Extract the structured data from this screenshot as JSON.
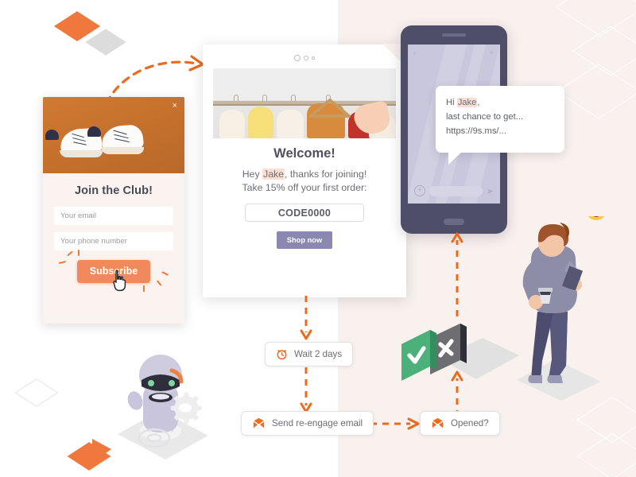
{
  "scene": {
    "title": "Marketing automation flow illustration",
    "background_left": "#ffffff",
    "background_right": "#f8f1ee",
    "accent_orange": "#f0773a",
    "accent_purple": "#8a87b0",
    "accent_green": "#4caf7d",
    "accent_dark": "#4e4e69"
  },
  "popup": {
    "name": "signup-popup",
    "close_label": "×",
    "title": "Join the Club!",
    "email_placeholder": "Your email",
    "phone_placeholder": "Your phone number",
    "email_value": "",
    "phone_value": "",
    "subscribe_label": "Subscribe",
    "hero_bg": "#c4702c"
  },
  "email": {
    "name": "welcome-email",
    "heading": "Welcome!",
    "greeting_prefix": "Hey ",
    "greeting_name": "Jake",
    "greeting_suffix": ", thanks for joining!",
    "offer_line": "Take 15% off your first order:",
    "promo_code": "CODE0000",
    "cta_label": "Shop now",
    "cta_color": "#8a87b0"
  },
  "phone": {
    "name": "sms-phone",
    "back_icon": "‹",
    "settings_icon": "⚬",
    "plus_icon": "+",
    "send_icon": "➤",
    "input_value": ""
  },
  "sms": {
    "name": "sms-bubble",
    "line1_prefix": "Hi ",
    "line1_name": "Jake",
    "line1_suffix": ",",
    "line2": "last chance to get...",
    "line3": "https://9s.ms/..."
  },
  "workflow": {
    "nodes": [
      {
        "name": "node-wait",
        "label": "Wait 2 days",
        "icon": "alarm-clock-icon"
      },
      {
        "name": "node-send-email",
        "label": "Send re-engage email",
        "icon": "envelope-icon"
      },
      {
        "name": "node-opened",
        "label": "Opened?",
        "icon": "envelope-icon"
      }
    ],
    "decision": {
      "yes_icon": "check-icon",
      "no_icon": "cross-icon",
      "yes_color": "#4caf7d",
      "no_color": "#6e6e72"
    }
  },
  "decor": {
    "robot_name": "robot-illustration",
    "gear_name": "gear-icon",
    "person_name": "person-with-phone-illustration",
    "emoji_name": "heart-eyes-emoji",
    "cursor_name": "hand-cursor-icon"
  }
}
